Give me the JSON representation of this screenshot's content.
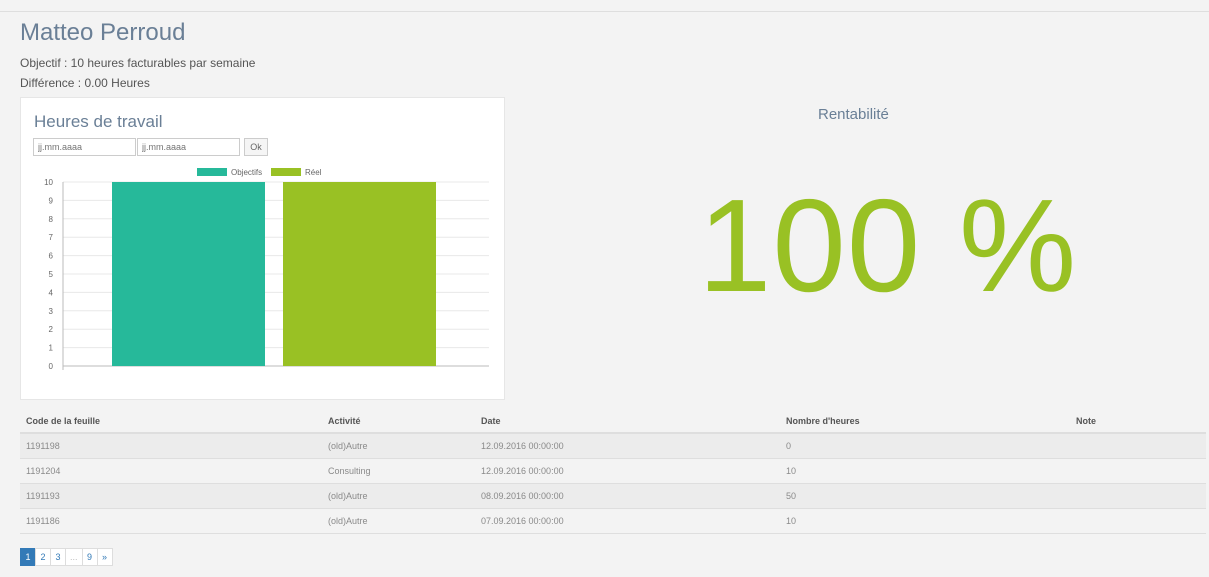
{
  "header": {
    "name": "Matteo Perroud",
    "objective": "Objectif : 10 heures facturables par semaine",
    "difference": "Différence : 0.00 Heures"
  },
  "work_panel": {
    "title": "Heures de travail",
    "date_from_placeholder": "jj.mm.aaaa",
    "date_to_placeholder": "jj.mm.aaaa",
    "ok_label": "Ok"
  },
  "chart_data": {
    "type": "bar",
    "categories": [
      ""
    ],
    "series": [
      {
        "name": "Objectifs",
        "values": [
          10
        ],
        "color": "#26b99a"
      },
      {
        "name": "Réel",
        "values": [
          10
        ],
        "color": "#99c124"
      }
    ],
    "ylim": [
      0,
      10
    ],
    "yticks": [
      "0",
      "1",
      "2",
      "3",
      "4",
      "5",
      "6",
      "7",
      "8",
      "9",
      "10"
    ],
    "grid": true,
    "legend": "top-center"
  },
  "rentabilite": {
    "title": "Rentabilité",
    "value": "100 %",
    "color": "#99c124"
  },
  "table": {
    "headers": [
      "Code de la feuille",
      "Activité",
      "Date",
      "Nombre d'heures",
      "Note"
    ],
    "rows": [
      [
        "1191198",
        "(old)Autre",
        "12.09.2016 00:00:00",
        "0",
        ""
      ],
      [
        "1191204",
        "Consulting",
        "12.09.2016 00:00:00",
        "10",
        ""
      ],
      [
        "1191193",
        "(old)Autre",
        "08.09.2016 00:00:00",
        "50",
        ""
      ],
      [
        "1191186",
        "(old)Autre",
        "07.09.2016 00:00:00",
        "10",
        ""
      ]
    ]
  },
  "pagination": {
    "items": [
      "1",
      "2",
      "3",
      "...",
      "9",
      "»"
    ],
    "active": "1"
  }
}
